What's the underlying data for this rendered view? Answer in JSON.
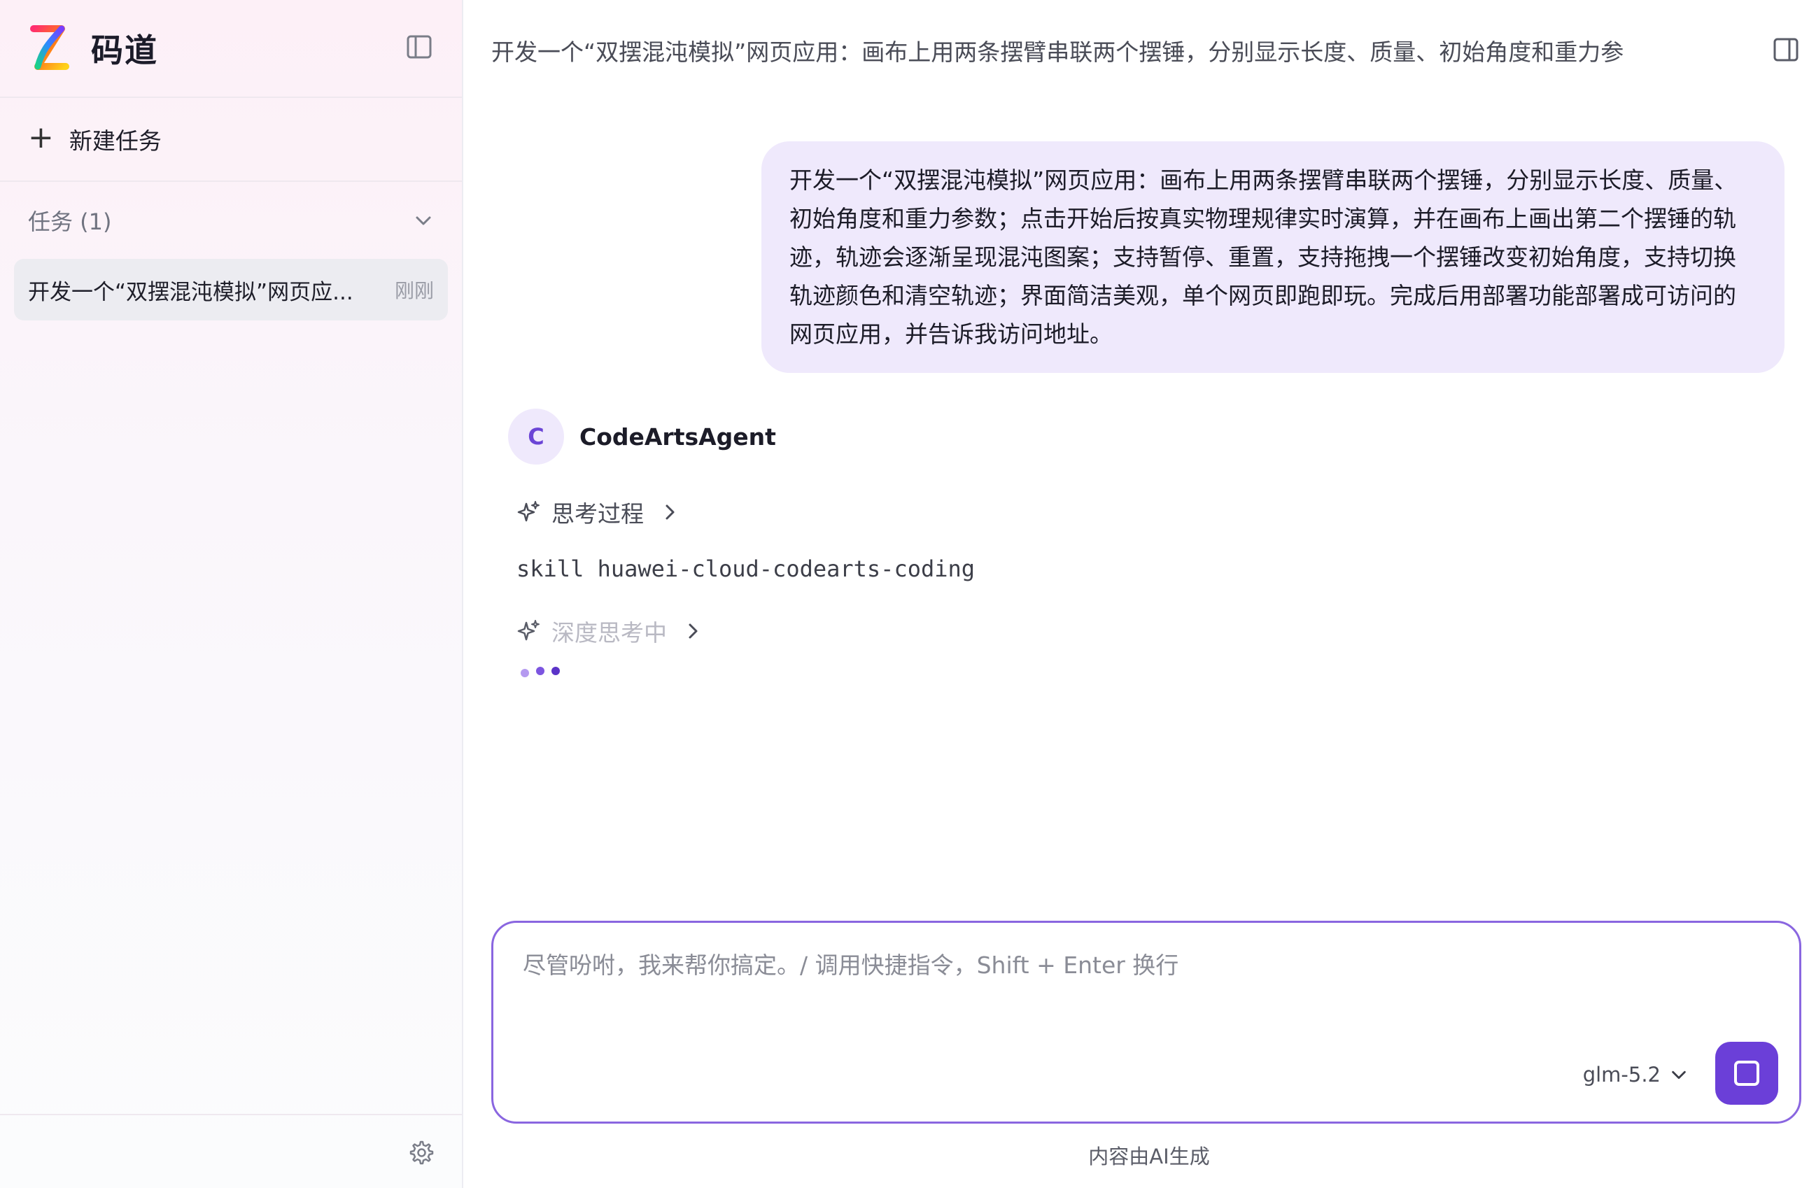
{
  "sidebar": {
    "brand": "码道",
    "new_task_label": "新建任务",
    "task_group_label": "任务 (1)",
    "tasks": [
      {
        "title": "开发一个“双摆混沌模拟”网页应...",
        "time": "刚刚"
      }
    ]
  },
  "header": {
    "title": "开发一个“双摆混沌模拟”网页应用：画布上用两条摆臂串联两个摆锤，分别显示长度、质量、初始角度和重力参"
  },
  "chat": {
    "user_message": "开发一个“双摆混沌模拟”网页应用：画布上用两条摆臂串联两个摆锤，分别显示长度、质量、初始角度和重力参数；点击开始后按真实物理规律实时演算，并在画布上画出第二个摆锤的轨迹，轨迹会逐渐呈现混沌图案；支持暂停、重置，支持拖拽一个摆锤改变初始角度，支持切换轨迹颜色和清空轨迹；界面简洁美观，单个网页即跑即玩。完成后用部署功能部署成可访问的网页应用，并告诉我访问地址。",
    "agent": {
      "avatar_letter": "C",
      "name": "CodeArtsAgent"
    },
    "thinking_label": "思考过程",
    "skill_line": "skill huawei-cloud-codearts-coding",
    "deep_thinking_label": "深度思考中"
  },
  "composer": {
    "placeholder": "尽管吩咐，我来帮你搞定。/ 调用快捷指令，Shift + Enter 换行",
    "model": "glm-5.2"
  },
  "footnote": "内容由AI生成",
  "colors": {
    "accent": "#6b3fd8",
    "bubble_bg": "#efe9fc",
    "input_border": "#8a66e0"
  },
  "icons": {
    "logo": "codearts-logo-icon",
    "sidebar_toggle": "sidebar-toggle-icon",
    "new_task": "plus-icon",
    "group_chevron": "chevron-down-icon",
    "settings": "gear-icon",
    "right_panel": "panel-toggle-icon",
    "thinking": "sparkle-icon",
    "expand": "chevron-right-icon",
    "send": "stop-icon"
  }
}
